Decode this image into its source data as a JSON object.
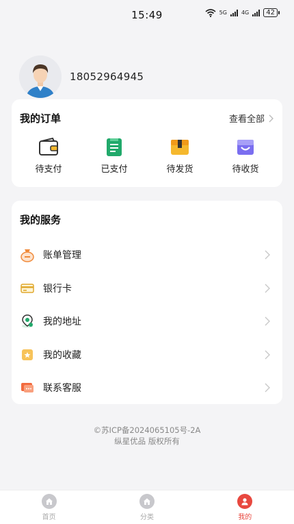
{
  "status_bar": {
    "time": "15:49",
    "net1": "5G",
    "net2": "4G",
    "battery": "42"
  },
  "profile": {
    "phone": "18052964945"
  },
  "orders": {
    "title": "我的订单",
    "view_all": "查看全部",
    "items": [
      {
        "label": "待支付",
        "icon": "wallet-icon"
      },
      {
        "label": "已支付",
        "icon": "receipt-icon"
      },
      {
        "label": "待发货",
        "icon": "package-icon"
      },
      {
        "label": "待收货",
        "icon": "shopping-bag-icon"
      }
    ]
  },
  "services": {
    "title": "我的服务",
    "items": [
      {
        "label": "账单管理",
        "icon": "money-bag-icon"
      },
      {
        "label": "银行卡",
        "icon": "bank-card-icon"
      },
      {
        "label": "我的地址",
        "icon": "location-pin-icon"
      },
      {
        "label": "我的收藏",
        "icon": "favorite-icon"
      },
      {
        "label": "联系客服",
        "icon": "chat-service-icon"
      }
    ]
  },
  "footer": {
    "icp": "©苏ICP备2024065105号-2A",
    "copyright": "纵星优品 版权所有"
  },
  "tabbar": {
    "items": [
      {
        "label": "首页",
        "active": false
      },
      {
        "label": "分类",
        "active": false
      },
      {
        "label": "我的",
        "active": true
      }
    ]
  },
  "colors": {
    "accent": "#e8483f",
    "order_green": "#21a96b",
    "order_yellow": "#f5b82e",
    "order_purple": "#7a6ef0"
  }
}
